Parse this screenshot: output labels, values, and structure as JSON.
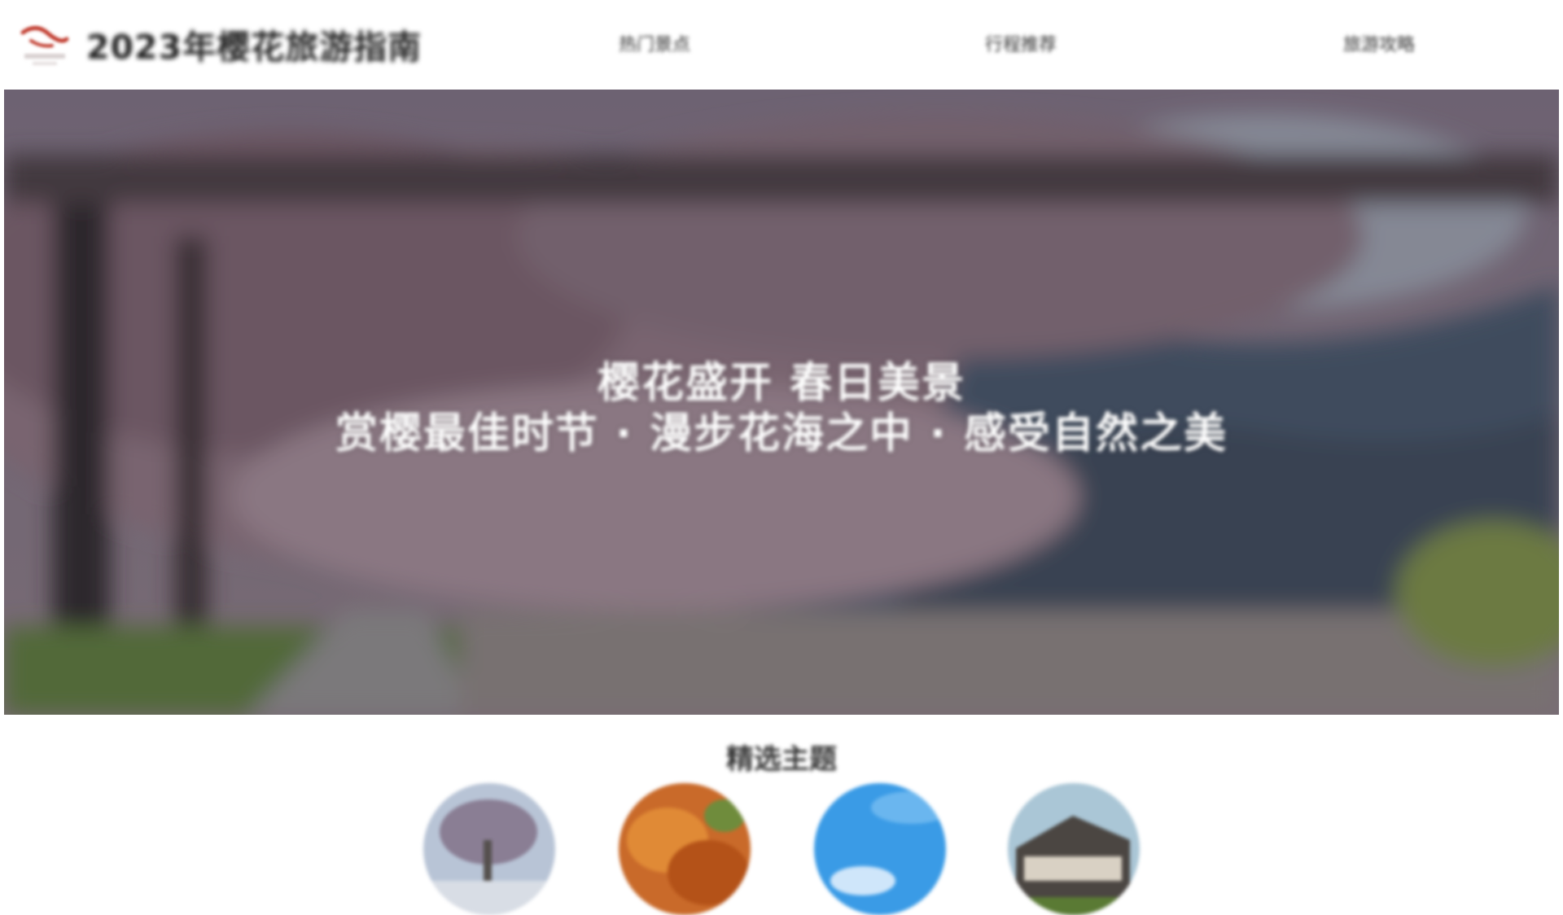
{
  "header": {
    "site_title": "2023年樱花旅游指南",
    "nav": [
      {
        "label": "热门景点"
      },
      {
        "label": "行程推荐"
      },
      {
        "label": "旅游攻略"
      }
    ]
  },
  "hero": {
    "line1": "樱花盛开 春日美景",
    "line2": "赏樱最佳时节 · 漫步花海之中 · 感受自然之美"
  },
  "section": {
    "title": "精选主题",
    "items": [
      {
        "icon": "tree-photo-icon"
      },
      {
        "icon": "autumn-leaves-photo-icon"
      },
      {
        "icon": "sky-photo-icon"
      },
      {
        "icon": "building-photo-icon"
      }
    ]
  },
  "colors": {
    "header_bg": "#ffffff",
    "hero_overlay": "#6e5f68",
    "text_dark": "#333333",
    "text_light": "#ffffff"
  }
}
